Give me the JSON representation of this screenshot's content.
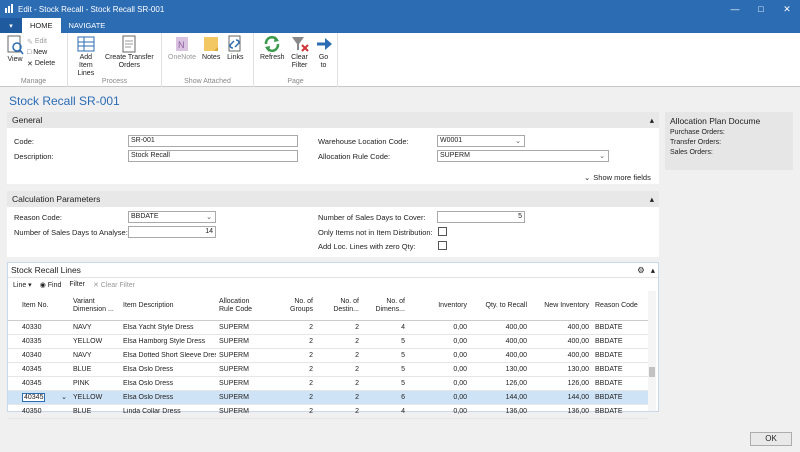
{
  "window": {
    "title": "Edit - Stock Recall - Stock Recall SR-001"
  },
  "ribbon": {
    "tabs": [
      "HOME",
      "NAVIGATE"
    ],
    "groups": {
      "manage": {
        "label": "Manage",
        "view": "View",
        "edit": "Edit",
        "new": "New",
        "delete": "Delete"
      },
      "process": {
        "label": "Process",
        "add_item_lines": "Add Item Lines",
        "create_transfer_orders": "Create Transfer Orders"
      },
      "show_attached": {
        "label": "Show Attached",
        "onenote": "OneNote",
        "notes": "Notes",
        "links": "Links"
      },
      "page": {
        "label": "Page",
        "refresh": "Refresh",
        "clear_filter": "Clear Filter",
        "go_to": "Go to"
      }
    }
  },
  "page_title": "Stock Recall SR-001",
  "general": {
    "header": "General",
    "code_label": "Code:",
    "code_value": "SR-001",
    "description_label": "Description:",
    "description_value": "Stock Recall",
    "warehouse_label": "Warehouse Location Code:",
    "warehouse_value": "W0001",
    "allocation_label": "Allocation Rule Code:",
    "allocation_value": "SUPERM",
    "show_more": "Show more fields"
  },
  "calc": {
    "header": "Calculation Parameters",
    "reason_label": "Reason Code:",
    "reason_value": "BBDATE",
    "days_analyse_label": "Number of Sales Days to Analyse:",
    "days_analyse_value": "14",
    "days_cover_label": "Number of Sales Days to Cover:",
    "days_cover_value": "5",
    "only_items_label": "Only Items not in Item Distribution:",
    "add_loc_label": "Add Loc. Lines with zero Qty:"
  },
  "lines": {
    "header": "Stock Recall Lines",
    "toolbar": {
      "line": "Line",
      "find": "Find",
      "filter": "Filter",
      "clear_filter": "Clear Filter"
    },
    "columns": [
      "Item No.",
      "Variant Dimension ...",
      "Item Description",
      "Allocation Rule Code",
      "No. of Groups",
      "No. of Destin...",
      "No. of Dimens...",
      "Inventory",
      "Qty. to Recall",
      "New Inventory",
      "Reason Code"
    ],
    "rows": [
      [
        "40330",
        "NAVY",
        "Elsa Yacht Style Dress",
        "SUPERM",
        "2",
        "2",
        "4",
        "0,00",
        "400,00",
        "400,00",
        "BBDATE"
      ],
      [
        "40335",
        "YELLOW",
        "Elsa Hamborg Style Dress",
        "SUPERM",
        "2",
        "2",
        "5",
        "0,00",
        "400,00",
        "400,00",
        "BBDATE"
      ],
      [
        "40340",
        "NAVY",
        "Elsa Dotted Short Sleeve Dress",
        "SUPERM",
        "2",
        "2",
        "5",
        "0,00",
        "400,00",
        "400,00",
        "BBDATE"
      ],
      [
        "40345",
        "BLUE",
        "Elsa Oslo Dress",
        "SUPERM",
        "2",
        "2",
        "5",
        "0,00",
        "130,00",
        "130,00",
        "BBDATE"
      ],
      [
        "40345",
        "PINK",
        "Elsa Oslo Dress",
        "SUPERM",
        "2",
        "2",
        "5",
        "0,00",
        "126,00",
        "126,00",
        "BBDATE"
      ],
      [
        "40345",
        "YELLOW",
        "Elsa Oslo Dress",
        "SUPERM",
        "2",
        "2",
        "6",
        "0,00",
        "144,00",
        "144,00",
        "BBDATE"
      ],
      [
        "40350",
        "BLUE",
        "Linda Collar Dress",
        "SUPERM",
        "2",
        "2",
        "4",
        "0,00",
        "136,00",
        "136,00",
        "BBDATE"
      ]
    ]
  },
  "factbox": {
    "title": "Allocation Plan Docume",
    "purchase_orders": "Purchase Orders:",
    "transfer_orders": "Transfer Orders:",
    "sales_orders": "Sales Orders:"
  },
  "ok_label": "OK"
}
